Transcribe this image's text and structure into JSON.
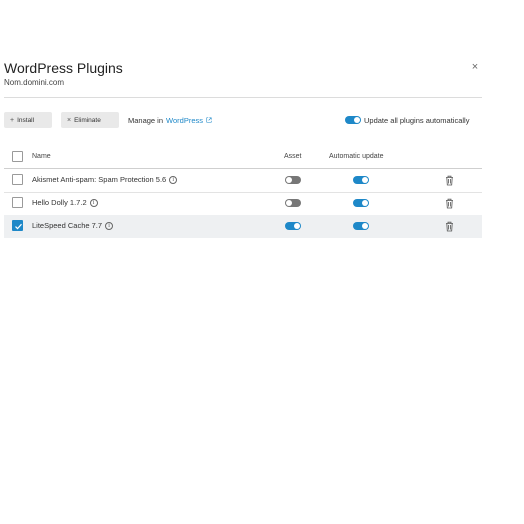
{
  "dialog": {
    "title": "WordPress Plugins",
    "subtitle": "Nom.domini.com",
    "close_label": "×"
  },
  "toolbar": {
    "install_label": "Install",
    "install_symbol": "+",
    "eliminate_label": "Eliminate",
    "eliminate_symbol": "×",
    "manage_prefix": "Manage in",
    "manage_link": "WordPress",
    "update_all_label": "Update all plugins automatically",
    "update_all_enabled": true
  },
  "table": {
    "columns": {
      "name": "Name",
      "asset": "Asset",
      "auto_update": "Automatic update"
    },
    "rows": [
      {
        "name": "Akismet Anti-spam: Spam Protection 5.6",
        "selected": false,
        "asset": false,
        "auto_update": true
      },
      {
        "name": "Hello Dolly 1.7.2",
        "selected": false,
        "asset": false,
        "auto_update": true
      },
      {
        "name": "LiteSpeed Cache 7.7",
        "selected": true,
        "asset": true,
        "auto_update": true
      }
    ]
  },
  "colors": {
    "accent": "#1e88c8",
    "toggle_off": "#777777",
    "selected_row": "#eef0f2"
  },
  "icons": {
    "info": "info-icon",
    "trash": "trash-icon",
    "external": "external-link-icon",
    "close": "close-icon"
  }
}
